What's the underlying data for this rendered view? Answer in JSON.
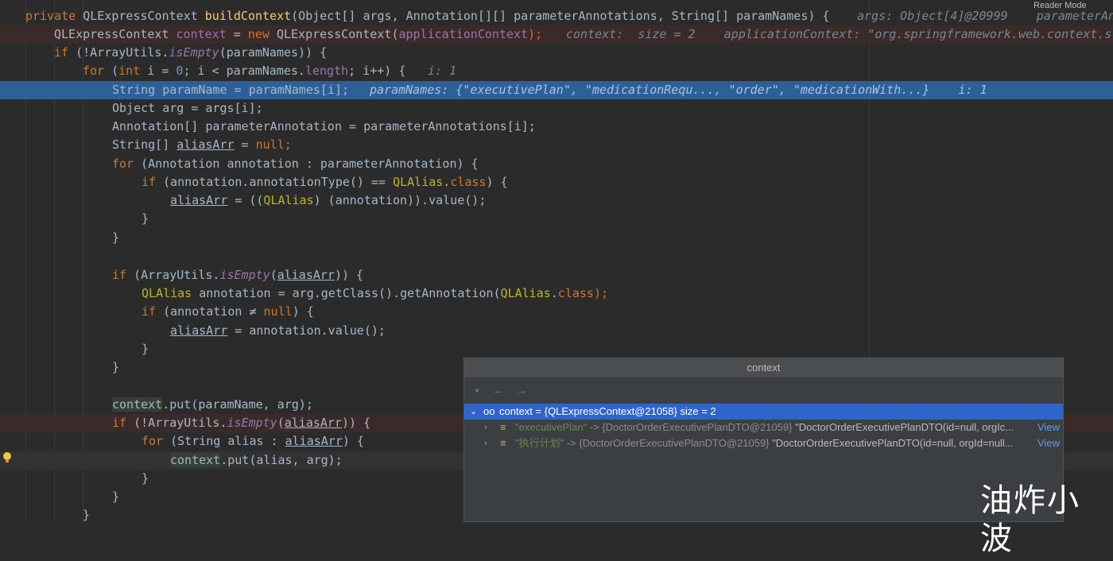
{
  "reader_mode": "Reader Mode",
  "code": {
    "l1": {
      "private": "private",
      "type": "QLExpressContext",
      "name": "buildContext",
      "params": "(Object[] args, Annotation[][] parameterAnnotations, String[] paramNames) {",
      "inline": "args: Object[4]@20999    parameterAn"
    },
    "l2": {
      "a": "QLExpressContext ",
      "ctx": "context",
      "b": " = ",
      "new": "new",
      "c": " QLExpressContext(",
      "ac": "applicationContext",
      "d": ");",
      "inline": "context:  size = 2    applicationContext: \"org.springframework.web.context.s"
    },
    "l3": {
      "if": "if",
      "a": " (!ArrayUtils.",
      "m": "isEmpty",
      "b": "(paramNames)) {"
    },
    "l4": {
      "for": "for",
      "a": " (",
      "int": "int",
      "b": " i = ",
      "zero": "0",
      "c": "; i < paramNames.",
      "len": "length",
      "d": "; i++) {",
      "inline": "i: 1"
    },
    "l5": {
      "a": "String paramName = paramNames[i];",
      "inline": "paramNames: {\"executivePlan\", \"medicationRequ..., \"order\", \"medicationWith...}    i: 1"
    },
    "l6": "Object arg = args[i];",
    "l7": "Annotation[] parameterAnnotation = parameterAnnotations[i];",
    "l8": {
      "a": "String[] ",
      "v": "aliasArr",
      "b": " = ",
      "null": "null",
      "c": ";"
    },
    "l9": {
      "for": "for",
      "a": " (Annotation annotation : parameterAnnotation) {"
    },
    "l10": {
      "if": "if",
      "a": " (annotation.annotationType() == ",
      "qa": "QLAlias",
      "b": ".",
      "cls": "class",
      "c": ") {"
    },
    "l11": {
      "v": "aliasArr",
      "a": " = ((",
      "qa": "QLAlias",
      "b": ") (annotation)).value();"
    },
    "l12": "}",
    "l13": "}",
    "l14": {
      "if": "if",
      "a": " (ArrayUtils.",
      "m": "isEmpty",
      "b": "(",
      "v": "aliasArr",
      "c": ")) {"
    },
    "l15": {
      "qa": "QLAlias",
      "a": " annotation = arg.getClass().getAnnotation(",
      "qa2": "QLAlias",
      "b": ".",
      "cls": "class",
      "c": ");"
    },
    "l16": {
      "if": "if",
      "a": " (annotation ≠ ",
      "null": "null",
      "b": ") {"
    },
    "l17": {
      "v": "aliasArr",
      "a": " = annotation.value();"
    },
    "l18": "}",
    "l19": "}",
    "l20": {
      "ctx": "context",
      "a": ".put(paramName, arg);"
    },
    "l21": {
      "if": "if",
      "a": " (!ArrayUtils.",
      "m": "isEmpty",
      "b": "(",
      "v": "aliasArr",
      "c": ")) {"
    },
    "l22": {
      "for": "for",
      "a": " (String alias : ",
      "v": "aliasArr",
      "b": ") {"
    },
    "l23": {
      "ctx": "context",
      "a": ".put(alias, arg);"
    },
    "l24": "}",
    "l25": "}",
    "l26": "}"
  },
  "popup": {
    "title": "context",
    "root": {
      "label": "context = {QLExpressContext@21058}  size = 2"
    },
    "entries": [
      {
        "key": "\"executivePlan\"",
        "arrow": " -> ",
        "type": "{DoctorOrderExecutivePlanDTO@21059}",
        "value": " \"DoctorOrderExecutivePlanDTO(id=null, orgIc...",
        "view": "View"
      },
      {
        "key": "\"执行计划\"",
        "arrow": " -> ",
        "type": "{DoctorOrderExecutivePlanDTO@21059}",
        "value": " \"DoctorOrderExecutivePlanDTO(id=null, orgId=null...",
        "view": "View"
      }
    ]
  },
  "watermark": "油炸小波"
}
